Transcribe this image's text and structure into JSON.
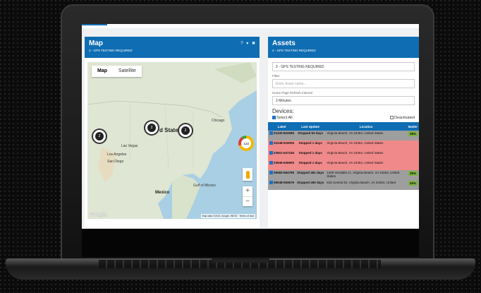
{
  "map_panel": {
    "title": "Map",
    "subtitle": "2 - GPS TESTING REQUIRED",
    "controls": [
      "?",
      "▾",
      "✖"
    ],
    "tabs": [
      {
        "label": "Map",
        "active": true
      },
      {
        "label": "Satellite",
        "active": false
      }
    ],
    "clusters": [
      "2",
      "2",
      "2",
      "2"
    ],
    "big_cluster": "123",
    "map_labels": [
      "d State",
      "Mexico",
      "Gulf of Mexico",
      "Las Vegas",
      "Los Angeles",
      "San Diego",
      "Chicago"
    ],
    "google_logo": "Google",
    "attribution": "Map data ©2021 Google, INEGI · Terms of Use",
    "zoom_in": "+",
    "zoom_out": "−"
  },
  "assets_panel": {
    "title": "Assets",
    "subtitle": "2 - GPS TESTING REQUIRED",
    "group_select_value": "2 - GPS TESTING REQUIRED",
    "filter_label": "Filter:",
    "filter_placeholder": "Enter Asset name...",
    "refresh_label": "Home Page Refresh Interval",
    "refresh_value": "2 Minutes",
    "devices_title": "Devices:",
    "select_all": "Select All",
    "deactivated": "Deactivated",
    "columns": [
      "Label",
      "Last Update",
      "Location",
      "Batter"
    ],
    "rows": [
      {
        "label": "01430-822695",
        "update": "Stopped 63 days",
        "location": "Virginia Beach, VA 23454, United States",
        "battery": "39%",
        "status": "gray"
      },
      {
        "label": "02248-519005",
        "update": "Stopped 1 days",
        "location": "Virginia Beach, VA 23454, United States",
        "battery": "",
        "status": "red"
      },
      {
        "label": "03501-637245",
        "update": "Stopped 1 days",
        "location": "Virginia Beach, VA 23454, United States",
        "battery": "",
        "status": "red"
      },
      {
        "label": "03949-636905",
        "update": "Stopped 1 days",
        "location": "Virginia Beach, VA 23454, United States",
        "battery": "",
        "status": "red"
      },
      {
        "label": "06083-594795",
        "update": "Stopped 451 days",
        "location": "1400 Vendalia Ct, Virginia Beach, VA 23454, United States",
        "battery": "35%",
        "status": "gray"
      },
      {
        "label": "08048-593675",
        "update": "Stopped 450 days",
        "location": "515 Central Dr, Virginia Beach, VA 23454, United",
        "battery": "40%",
        "status": "gray"
      }
    ]
  },
  "colors": {
    "header_blue": "#0f6db3",
    "stopped_red": "#f08a8a",
    "inactive_gray": "#9e9e9e",
    "battery_green": "#7cb342"
  }
}
